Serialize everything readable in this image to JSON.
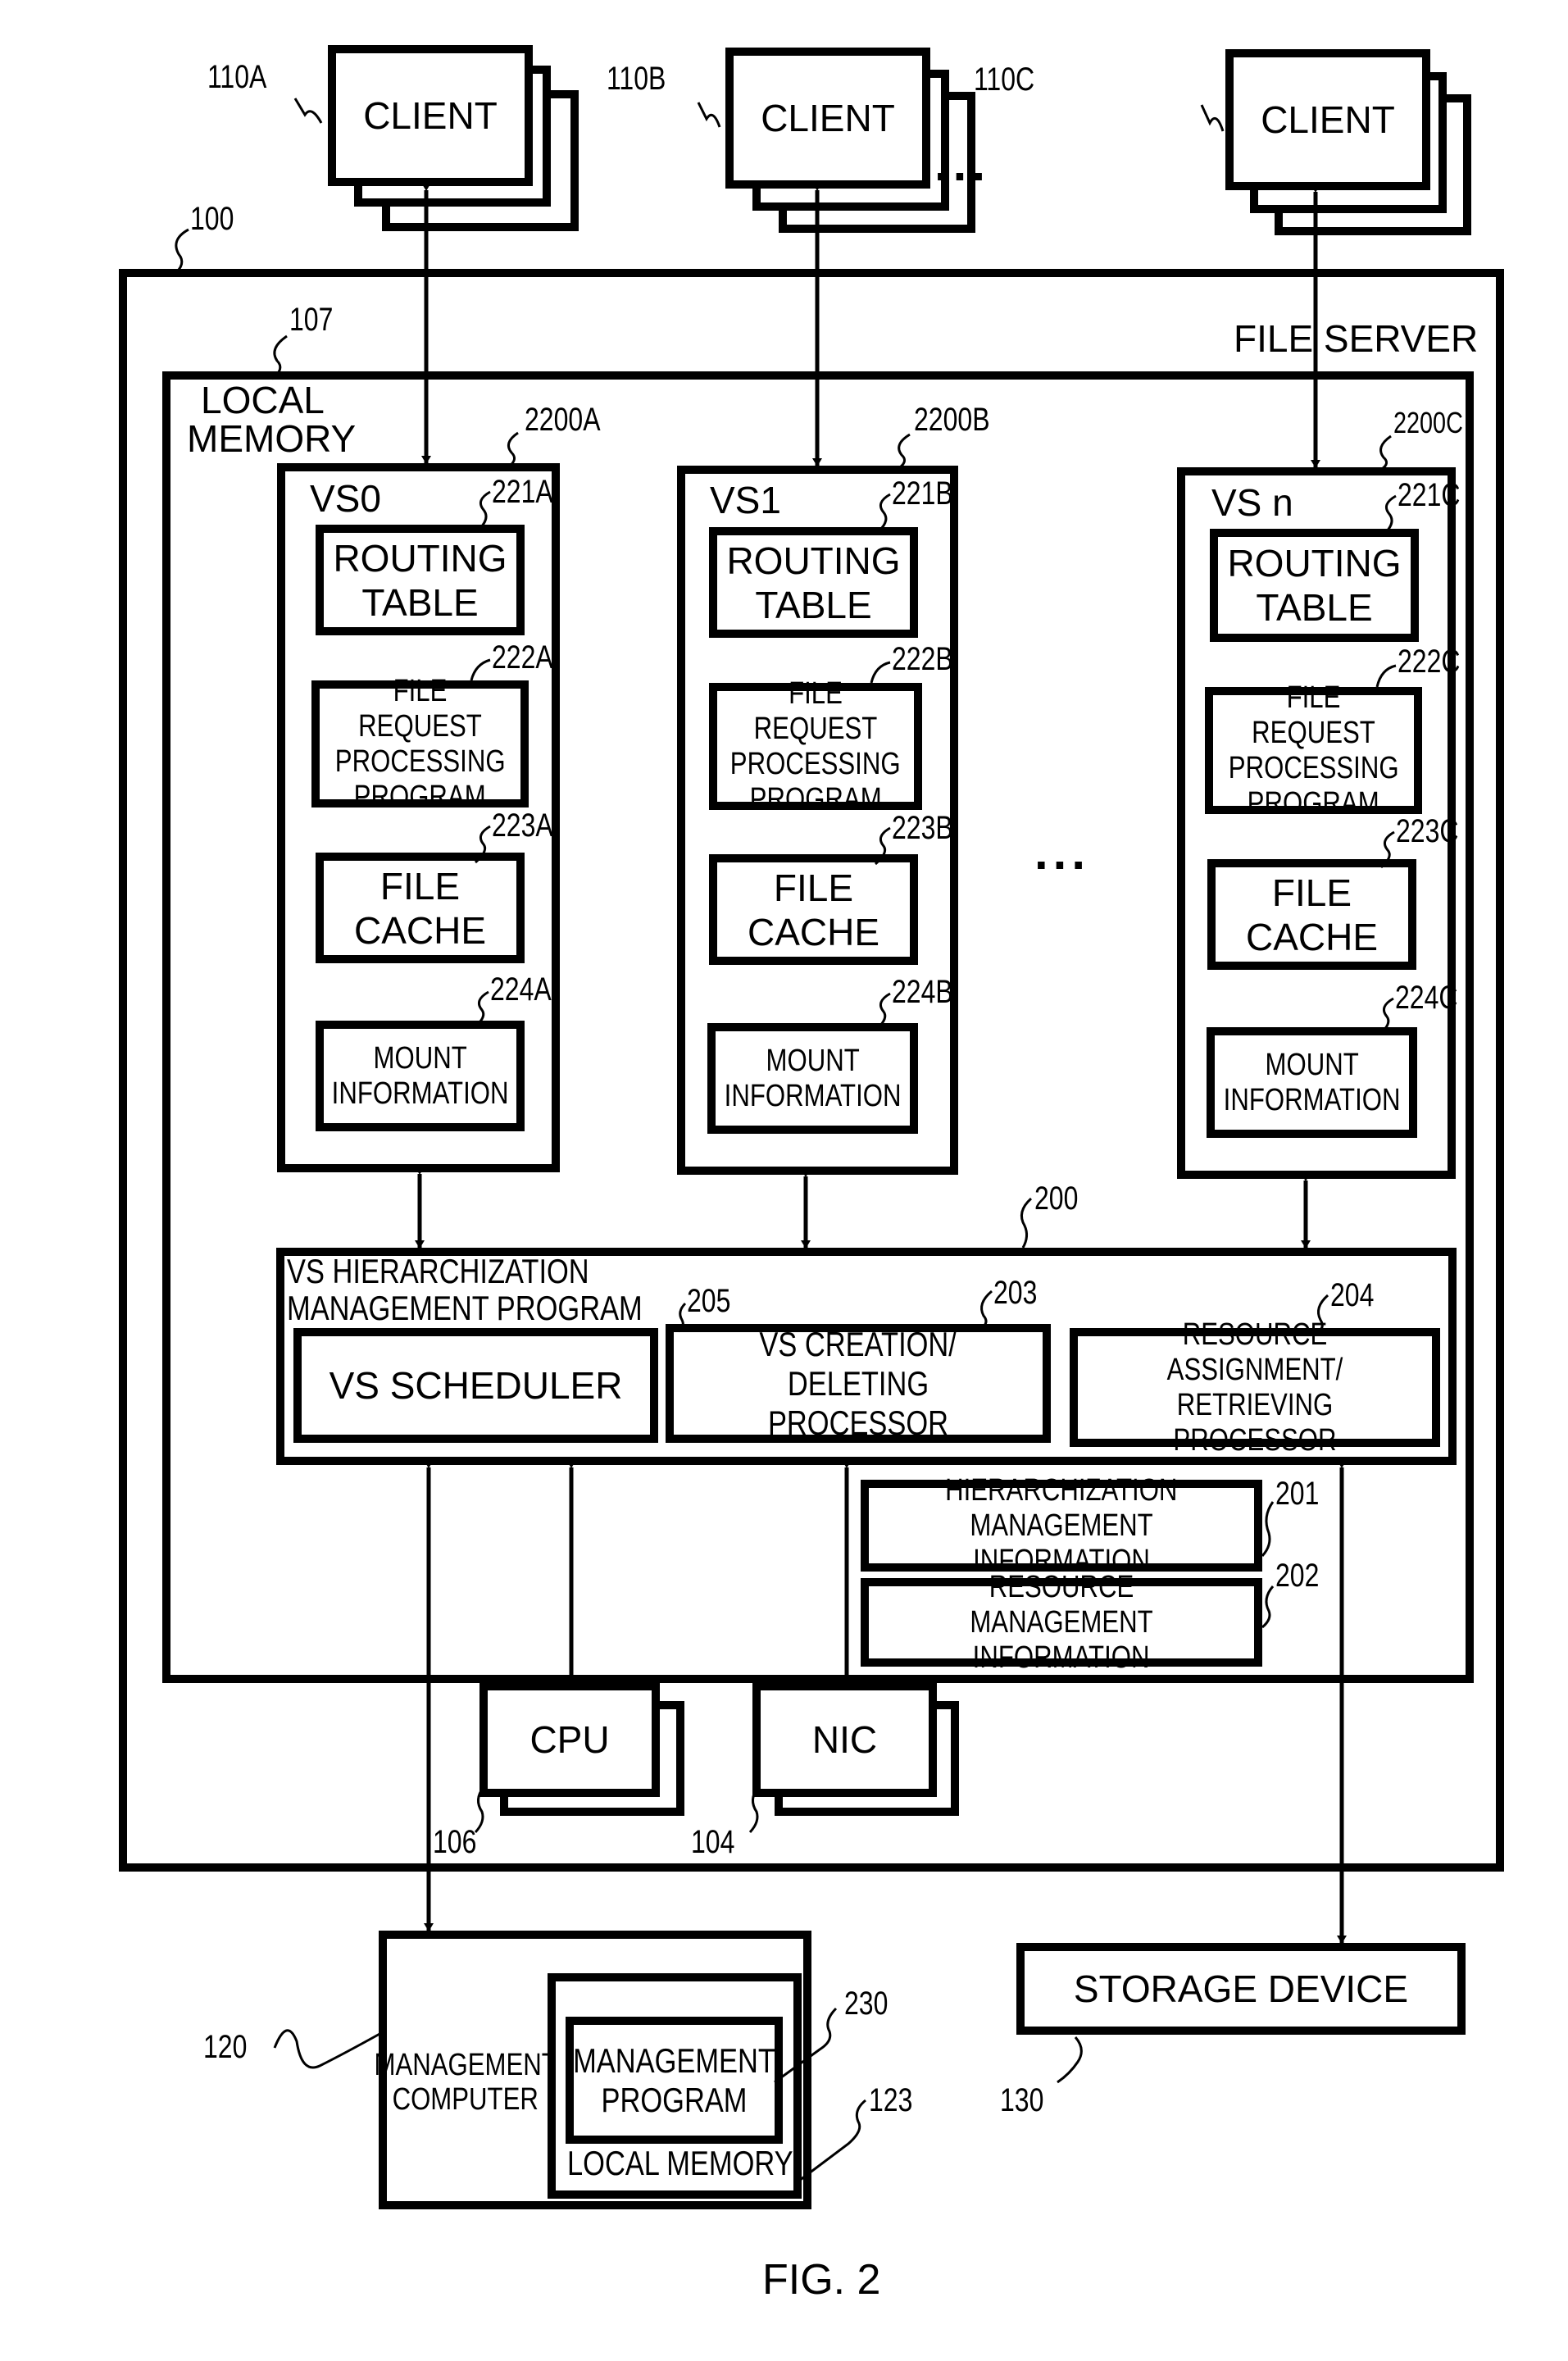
{
  "figure": {
    "caption": "FIG. 2",
    "clients": [
      {
        "ref": "110A",
        "label": "CLIENT"
      },
      {
        "ref": "110B",
        "label": "CLIENT"
      },
      {
        "ref": "110C",
        "label": "CLIENT"
      }
    ],
    "client_ellipsis": "...",
    "file_server": {
      "ref": "100",
      "label": "FILE SERVER"
    },
    "local_memory": {
      "ref": "107",
      "label_line1": "LOCAL",
      "label_line2": "MEMORY"
    },
    "virtual_servers": [
      {
        "ref": "2200A",
        "name": "VS0",
        "routing": {
          "ref": "221A",
          "l1": "ROUTING",
          "l2": "TABLE"
        },
        "frp": {
          "ref": "222A",
          "l1": "FILE REQUEST",
          "l2": "PROCESSING",
          "l3": "PROGRAM"
        },
        "cache": {
          "ref": "223A",
          "l1": "FILE",
          "l2": "CACHE"
        },
        "mount": {
          "ref": "224A",
          "l1": "MOUNT",
          "l2": "INFORMATION"
        }
      },
      {
        "ref": "2200B",
        "name": "VS1",
        "routing": {
          "ref": "221B",
          "l1": "ROUTING",
          "l2": "TABLE"
        },
        "frp": {
          "ref": "222B",
          "l1": "FILE REQUEST",
          "l2": "PROCESSING",
          "l3": "PROGRAM"
        },
        "cache": {
          "ref": "223B",
          "l1": "FILE",
          "l2": "CACHE"
        },
        "mount": {
          "ref": "224B",
          "l1": "MOUNT",
          "l2": "INFORMATION"
        }
      },
      {
        "ref": "2200C",
        "name": "VS n",
        "routing": {
          "ref": "221C",
          "l1": "ROUTING",
          "l2": "TABLE"
        },
        "frp": {
          "ref": "222C",
          "l1": "FILE REQUEST",
          "l2": "PROCESSING",
          "l3": "PROGRAM"
        },
        "cache": {
          "ref": "223C",
          "l1": "FILE",
          "l2": "CACHE"
        },
        "mount": {
          "ref": "224C",
          "l1": "MOUNT",
          "l2": "INFORMATION"
        }
      }
    ],
    "vs_ellipsis": "...",
    "hier_program": {
      "ref": "200",
      "l1": "VS HIERARCHIZATION",
      "l2": "MANAGEMENT PROGRAM",
      "scheduler": {
        "ref": "205",
        "label": "VS SCHEDULER"
      },
      "creation": {
        "ref": "203",
        "l1": "VS CREATION/",
        "l2": "DELETING PROCESSOR"
      },
      "resource": {
        "ref": "204",
        "l1": "RESOURCE ASSIGNMENT/",
        "l2": "RETRIEVING PROCESSOR"
      }
    },
    "hier_info": {
      "ref": "201",
      "l1": "HIERARCHIZATION",
      "l2": "MANAGEMENT INFORMATION"
    },
    "res_info": {
      "ref": "202",
      "l1": "RESOURCE MANAGEMENT",
      "l2": "INFORMATION"
    },
    "cpu": {
      "ref": "106",
      "label": "CPU"
    },
    "nic": {
      "ref": "104",
      "label": "NIC"
    },
    "mgmt_computer": {
      "ref": "120",
      "l1": "MANAGEMENT",
      "l2": "COMPUTER",
      "local_memory": {
        "ref": "123",
        "label": "LOCAL MEMORY"
      },
      "program": {
        "ref": "230",
        "l1": "MANAGEMENT",
        "l2": "PROGRAM"
      }
    },
    "storage": {
      "ref": "130",
      "label": "STORAGE DEVICE"
    }
  }
}
